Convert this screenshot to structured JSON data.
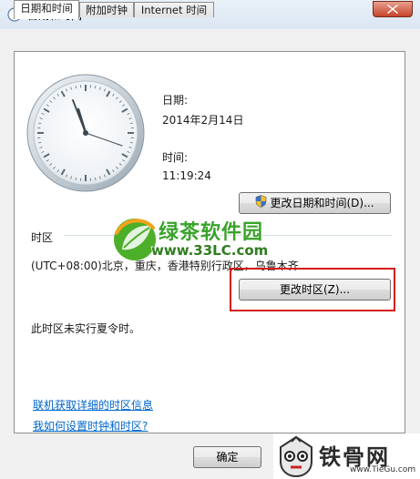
{
  "window": {
    "title": "日期和时间",
    "close_icon": "close-icon"
  },
  "tabs": [
    {
      "label": "日期和时间",
      "active": true
    },
    {
      "label": "附加时钟",
      "active": false
    },
    {
      "label": "Internet 时间",
      "active": false
    }
  ],
  "date": {
    "label": "日期:",
    "value": "2014年2月14日"
  },
  "time": {
    "label": "时间:",
    "value": "11:19:24"
  },
  "buttons": {
    "change_datetime": "更改日期和时间(D)...",
    "change_timezone": "更改时区(Z)...",
    "ok": "确定"
  },
  "timezone": {
    "group_label": "时区",
    "value": "(UTC+08:00)北京，重庆，香港特别行政区，乌鲁木齐",
    "dst_note": "此时区未实行夏令时。"
  },
  "links": {
    "online_info": "联机获取详细的时区信息",
    "how_to": "我如何设置时钟和时区?"
  },
  "watermark": {
    "name": "绿茶软件园",
    "url": "www.33LC.com"
  },
  "corner_logo": {
    "name": "铁骨网",
    "url": "www.TieGu.com"
  },
  "colors": {
    "highlight_box": "#d41b1b",
    "link": "#0066cc",
    "watermark_green": "#3aa32c"
  }
}
